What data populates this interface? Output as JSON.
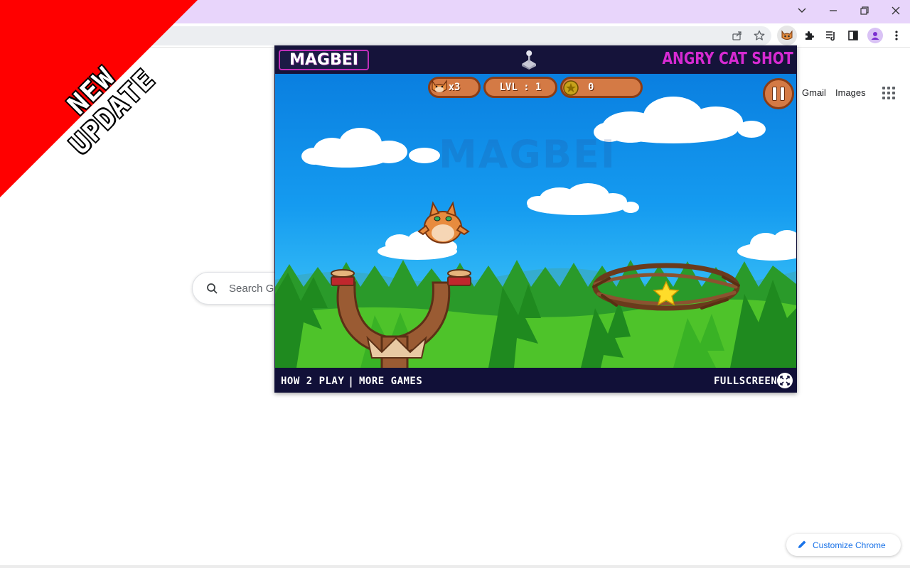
{
  "browser": {
    "colors": {
      "titlebar": "#e8d5fb",
      "omnibox": "#eceef1"
    },
    "window_controls": [
      "chevron-down-icon",
      "minimize-icon",
      "restore-icon",
      "close-icon"
    ],
    "toolbar_icons": [
      "share-icon",
      "bookmark-star-icon",
      "angry-cat-extension-icon",
      "extensions-puzzle-icon",
      "reading-list-icon",
      "side-panel-icon",
      "profile-avatar-icon",
      "more-menu-icon"
    ]
  },
  "ribbon": {
    "line1": "NEW",
    "line2": "UPDATE",
    "color": "#ff0000"
  },
  "ntp": {
    "gmail": "Gmail",
    "images": "Images",
    "search_placeholder": "Search Go",
    "customize": "Customize Chrome"
  },
  "game": {
    "brand": "MAGBEI",
    "title": "ANGRY CAT SHOT",
    "watermark": "MAGBEI",
    "hud": {
      "lives": "x3",
      "level": "LVL : 1",
      "score": "0"
    },
    "footer": {
      "how_to_play": "HOW 2 PLAY",
      "separator": "|",
      "more_games": "MORE GAMES",
      "fullscreen": "FULLSCREEN"
    },
    "colors": {
      "brand_pink": "#d62ad2",
      "hud_orange": "#d47a45",
      "sky": "#159bf0",
      "grass": "#3fb81f",
      "panel": "#111038"
    }
  }
}
